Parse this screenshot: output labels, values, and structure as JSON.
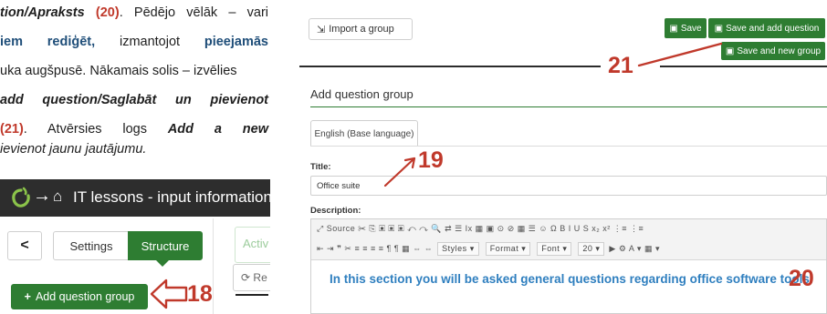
{
  "doc_text": {
    "line1": {
      "a": "tion/Apraksts",
      "b": "(20)",
      "c": ". Pēdējo vēlāk – vari"
    },
    "line2": {
      "a": "iem rediģēt,",
      "b": " izmantojot ",
      "c": "pieejamās"
    },
    "line3": "uka augšpusē. Nākamais solis – izvēlies",
    "line4": {
      "a": "add question/",
      "b": "Saglabāt un pievienot"
    },
    "line5": {
      "a": "(21)",
      "b": ". Atvērsies logs ",
      "c": "Add a new"
    },
    "line6": "ievienot jaunu jautājumu."
  },
  "left_shot": {
    "arrow_glyph": "→",
    "home_glyph": "⌂",
    "title": "IT lessons - input information",
    "back_glyph": "<",
    "settings_label": "Settings",
    "structure_label": "Structure",
    "active_label": "Activ",
    "re_label": "Re",
    "add_group_plus": "+",
    "add_group_label": "Add question group",
    "annotation": "18"
  },
  "right_shot": {
    "import_label": "Import a group",
    "save_label": "Save",
    "save_add_label": "Save and add question",
    "save_new_label": "Save and new group",
    "annotation_21": "21",
    "heading": "Add question group",
    "tab_label": "English (Base language)",
    "title_label": "Title:",
    "title_value": "Office suite",
    "annotation_19": "19",
    "description_label": "Description:",
    "toolbar_row1": "⤢   Source   ✂ ⎘ ▣ ▣ ▣   ↶ ↷  🔍 ⇄ ☰ Ix   ▦ ▣ ⊙ ⊘   ▦ ☰ ☺ Ω   B  I  U  S   x₂ x²   ⋮≡ ⋮≡",
    "toolbar_row2_a": "⇤ ⇥ ❞ ✂   ≡ ≡ ≡ ≡   ¶ ¶   ▦   ⇔ ⇔",
    "toolbar_styles": "Styles",
    "toolbar_format": "Format",
    "toolbar_font": "Font",
    "toolbar_size": "20",
    "toolbar_row2_b": "▶ ⚙   A ▾  ▦ ▾",
    "editor_text": "In this section you will be asked general questions regarding office software tools.",
    "annotation_20": "20"
  },
  "colors": {
    "accent_green": "#2e7d32",
    "annotation_red": "#c0392b",
    "editor_blue": "#2f7fbf"
  }
}
